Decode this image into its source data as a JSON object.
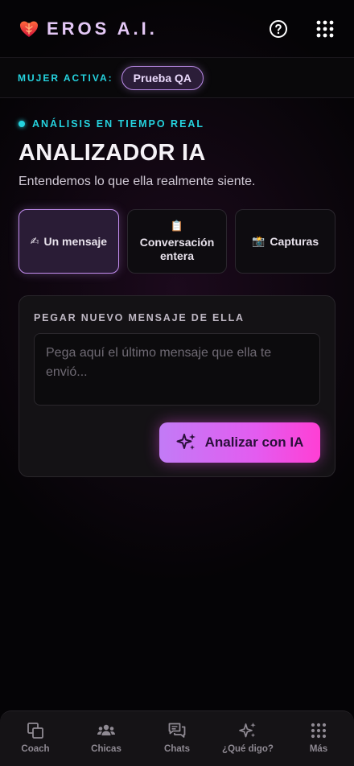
{
  "header": {
    "title": "EROS A.I.",
    "icons": {
      "brand": "heart-icon",
      "help": "help-circle-icon",
      "apps": "grid-icon"
    }
  },
  "active_woman": {
    "label": "MUJER ACTIVA:",
    "chip": "Prueba QA"
  },
  "section": {
    "live_label": "ANÁLISIS EN TIEMPO REAL",
    "title": "ANALIZADOR IA",
    "subtitle": "Entendemos lo que ella realmente siente."
  },
  "tabs": [
    {
      "emoji": "✍",
      "label": "Un mensaje",
      "active": true
    },
    {
      "emoji": "📋",
      "label": "Conversación entera",
      "active": false
    },
    {
      "emoji": "📸",
      "label": "Capturas",
      "active": false
    }
  ],
  "card": {
    "label": "PEGAR NUEVO MENSAJE DE ELLA",
    "input_value": "",
    "input_placeholder": "Pega aquí el último mensaje que ella te envió...",
    "button_label": "Analizar con IA"
  },
  "nav": [
    {
      "label": "Coach",
      "icon": "copy-icon"
    },
    {
      "label": "Chicas",
      "icon": "people-icon"
    },
    {
      "label": "Chats",
      "icon": "chat-icon"
    },
    {
      "label": "¿Qué digo?",
      "icon": "sparkles-icon"
    },
    {
      "label": "Más",
      "icon": "grid-icon"
    }
  ],
  "colors": {
    "accent_cyan": "#25d3df",
    "accent_purple": "#c38ef0",
    "button_gradient_start": "#c27bf6",
    "button_gradient_end": "#ff3fd4"
  }
}
